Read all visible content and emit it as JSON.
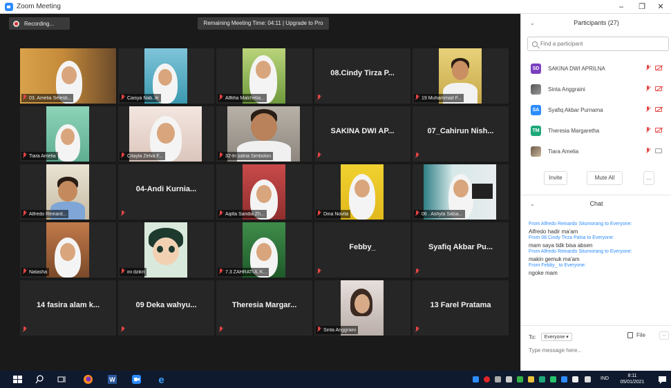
{
  "window": {
    "title": "Zoom Meeting",
    "minimize": "–",
    "maximize": "❐",
    "close": "✕"
  },
  "recording": {
    "label": "Recording..."
  },
  "banner": {
    "text": "Remaining Meeting Time: 04:11 | Upgrade to Pro"
  },
  "tiles": [
    {
      "label": "03. Amelia Selesti...",
      "name_text": ""
    },
    {
      "label": "Caisya Nab..le",
      "name_text": ""
    },
    {
      "label": "Alfkha Malchelia...",
      "name_text": ""
    },
    {
      "label": "",
      "name_text": "08.Cindy Tirza P..."
    },
    {
      "label": "19 Muhammad F...",
      "name_text": ""
    },
    {
      "label": "Tiara Amelia",
      "name_text": ""
    },
    {
      "label": "Citayla Zelva F...",
      "name_text": ""
    },
    {
      "label": "32-tri satria Simbolon",
      "name_text": ""
    },
    {
      "label": "",
      "name_text": "SAKINA DWI AP..."
    },
    {
      "label": "",
      "name_text": "07_Cahirun Nish..."
    },
    {
      "label": "Alfredo Reinard...",
      "name_text": ""
    },
    {
      "label": "",
      "name_text": "04-Andi Kurnia..."
    },
    {
      "label": "Aqilla Sandia Zh...",
      "name_text": ""
    },
    {
      "label": "Dina Novita",
      "name_text": ""
    },
    {
      "label": "06 . Ashyla Salsa...",
      "name_text": ""
    },
    {
      "label": "Natasha",
      "name_text": ""
    },
    {
      "label": "ini dzikri",
      "name_text": ""
    },
    {
      "label": "7.3 ZAHRATUL K...",
      "name_text": ""
    },
    {
      "label": "",
      "name_text": "Febby_"
    },
    {
      "label": "",
      "name_text": "Syafiq Akbar Pu..."
    },
    {
      "label": "",
      "name_text": "14 fasira alam k..."
    },
    {
      "label": "",
      "name_text": "09 Deka wahyu..."
    },
    {
      "label": "",
      "name_text": "Theresia Margar..."
    },
    {
      "label": "Sinta Anggraini",
      "name_text": ""
    },
    {
      "label": "",
      "name_text": "13 Farel Pratama"
    }
  ],
  "participants_panel": {
    "title": "Participants (27)",
    "search_placeholder": "Find a participant",
    "items": [
      {
        "initials": "SD",
        "name": "SAKINA DWI APRILNA",
        "color": "#7b3fbf",
        "avatar": "initials"
      },
      {
        "initials": "",
        "name": "Sinta Anggraini",
        "color": "#666666",
        "avatar": "photo"
      },
      {
        "initials": "SA",
        "name": "Syafiq Akbar Purnama",
        "color": "#2d8cff",
        "avatar": "initials"
      },
      {
        "initials": "TM",
        "name": "Theresia Margaretha",
        "color": "#1fa87a",
        "avatar": "initials"
      },
      {
        "initials": "",
        "name": "Tiara Amelia",
        "color": "#666666",
        "avatar": "photo"
      }
    ],
    "invite": "Invite",
    "mute_all": "Mute All",
    "more": "..."
  },
  "chat": {
    "title": "Chat",
    "messages": [
      {
        "from": "From Alfredo Reinardo Situmorang to Everyone:",
        "text": "Alfredo hadir ma'am"
      },
      {
        "from": "From 08.Cindy Tirza Palsa to Everyone:",
        "text": "mam saya tidk bisa absen"
      },
      {
        "from": "From Alfredo Reinardo Situmorang to Everyone:",
        "text": "makin gemuk ma'am"
      },
      {
        "from": "From Febby_ to Everyone:",
        "text": "ngoke mam"
      }
    ],
    "to_label": "To:",
    "to_value": "Everyone ▾",
    "file_label": "File",
    "more": "...",
    "input_placeholder": "Type message here..."
  },
  "taskbar": {
    "lang": "IND",
    "time": "8:11",
    "date": "05/01/2021"
  },
  "colors": {
    "accent": "#2d8cff",
    "mic_off": "#e64545",
    "video_bg": "#1a1a1a",
    "tile_bg": "#262626",
    "taskbar": "#0f1a2e"
  }
}
